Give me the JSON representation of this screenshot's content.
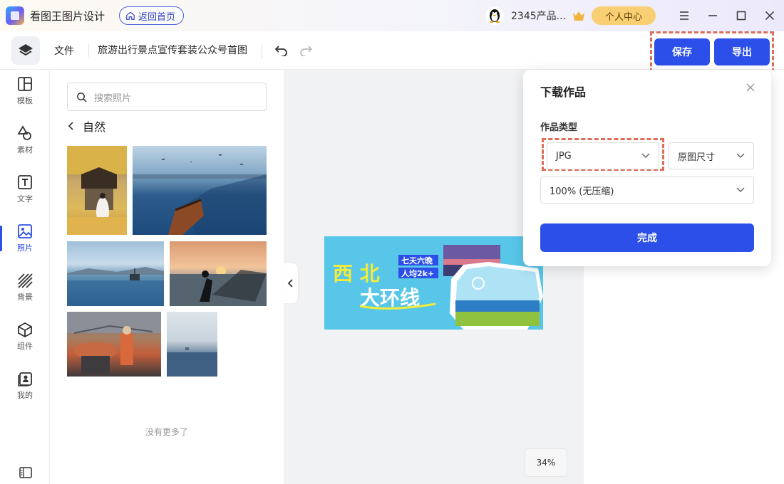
{
  "app": {
    "name": "看图王图片设计",
    "home_button": "返回首页",
    "username": "2345产品...",
    "personal_center": "个人中心"
  },
  "toolbar": {
    "file_menu": "文件",
    "doc_title": "旅游出行景点宣传套装公众号首图",
    "save_label": "保存",
    "export_label": "导出"
  },
  "leftnav": {
    "items": [
      {
        "label": "模板",
        "icon": "template-icon"
      },
      {
        "label": "素材",
        "icon": "shapes-icon"
      },
      {
        "label": "文字",
        "icon": "text-icon"
      },
      {
        "label": "照片",
        "icon": "photo-icon"
      },
      {
        "label": "背景",
        "icon": "background-icon"
      },
      {
        "label": "组件",
        "icon": "cube-icon"
      },
      {
        "label": "我的",
        "icon": "my-icon"
      }
    ],
    "active_index": 3
  },
  "photo_panel": {
    "search_placeholder": "搜索照片",
    "category": "自然",
    "no_more": "没有更多了"
  },
  "canvas": {
    "zoom": "34%",
    "poster": {
      "title_line1": "西 北",
      "title_line2": "大环线",
      "tag_line1": "七天六晚",
      "tag_line2": "人均2k+"
    }
  },
  "download_popover": {
    "title": "下载作品",
    "type_label": "作品类型",
    "format": "JPG",
    "size": "原图尺寸",
    "quality": "100% (无压缩)",
    "done": "完成"
  },
  "colors": {
    "primary": "#2b4fe8",
    "highlight_dash": "#e06d5a",
    "vip_gold": "#f9cf74"
  }
}
